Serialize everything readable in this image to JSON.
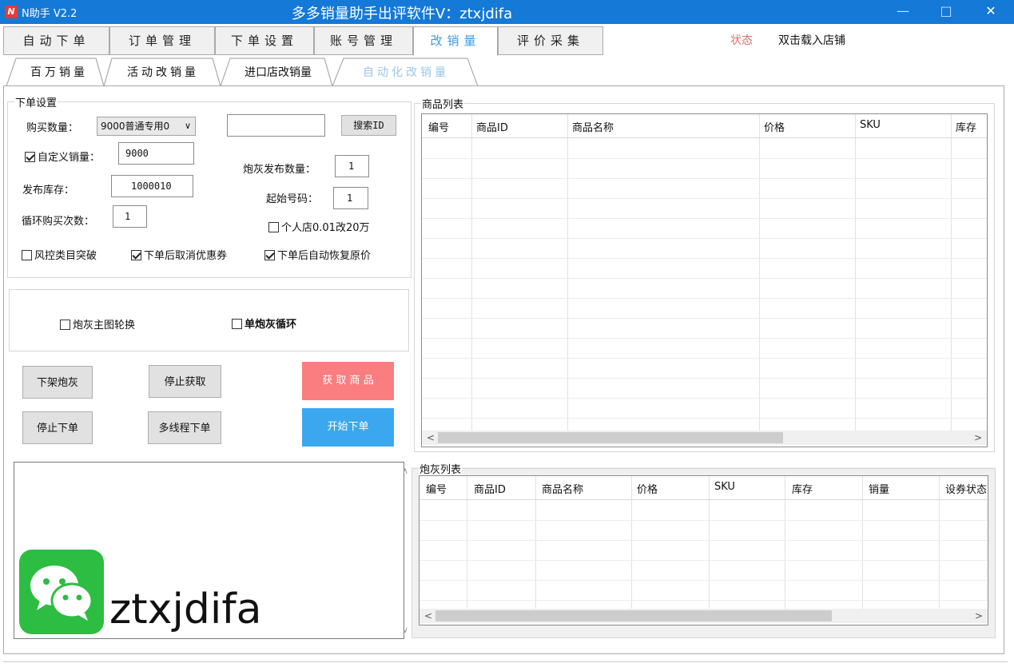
{
  "window": {
    "app_name": "N助手 V2.2",
    "title": "多多销量助手出评软件V：ztxjdifa",
    "controls": {
      "minimize": "—",
      "maximize": "□",
      "close": "✕"
    }
  },
  "main_tabs": [
    {
      "label": "自动下单",
      "active": false
    },
    {
      "label": "订单管理",
      "active": false
    },
    {
      "label": "下单设置",
      "active": false
    },
    {
      "label": "账号管理",
      "active": false
    },
    {
      "label": "改销量",
      "active": true
    },
    {
      "label": "评价采集",
      "active": false
    }
  ],
  "status": {
    "label": "状态",
    "load_shop": "双击载入店铺"
  },
  "sub_tabs": [
    {
      "label": "百万销量",
      "active": false
    },
    {
      "label": "活动改销量",
      "active": false
    },
    {
      "label": "进口店改销量",
      "active": false
    },
    {
      "label": "自动化改销量",
      "active": true
    }
  ],
  "order_settings": {
    "legend": "下单设置",
    "buy_qty_label": "购买数量：",
    "buy_qty_select": "9000普通专用0",
    "search_input_value": "",
    "search_id_button": "搜索ID",
    "custom_sales_label": "自定义销量：",
    "custom_sales_checked": true,
    "custom_sales_value": "9000",
    "cannon_publish_qty_label": "炮灰发布数量：",
    "cannon_publish_qty_value": "1",
    "publish_stock_label": "发布库存：",
    "publish_stock_value": "1000010",
    "start_number_label": "起始号码：",
    "start_number_value": "1",
    "loop_buy_label": "循环购买次数：",
    "loop_buy_value": "1",
    "personal_shop_label": "个人店0.01改20万",
    "personal_shop_checked": false,
    "risk_category_label": "风控类目突破",
    "risk_category_checked": false,
    "cancel_coupon_label": "下单后取消优惠券",
    "cancel_coupon_checked": true,
    "restore_price_label": "下单后自动恢复原价",
    "restore_price_checked": true
  },
  "options": {
    "rotate_main_image_label": "炮灰主图轮换",
    "rotate_main_image_checked": false,
    "single_cannon_loop_label": "单炮灰循环",
    "single_cannon_loop_checked": false
  },
  "actions": {
    "delist_cannon": "下架炮灰",
    "stop_fetch": "停止获取",
    "fetch_goods": "获 取 商 品",
    "stop_order": "停止下单",
    "multithread_order": "多线程下单",
    "start_order": "开始下单"
  },
  "colors": {
    "titlebar": "#1479d7",
    "fetch_button": "#fa7d80",
    "start_button": "#3ba7ee",
    "active_tab_text": "#3b9ae0",
    "status_text": "#e0736e",
    "wechat_green": "#2dbd43"
  },
  "goods_list": {
    "legend": "商品列表",
    "columns": [
      "编号",
      "商品ID",
      "商品名称",
      "价格",
      "SKU",
      "库存"
    ],
    "rows": []
  },
  "cannon_list": {
    "legend": "炮灰列表",
    "columns": [
      "编号",
      "商品ID",
      "商品名称",
      "价格",
      "SKU",
      "库存",
      "销量",
      "设券状态"
    ],
    "rows": []
  },
  "watermark": {
    "icon": "wechat-icon",
    "text": "ztxjdifa"
  }
}
